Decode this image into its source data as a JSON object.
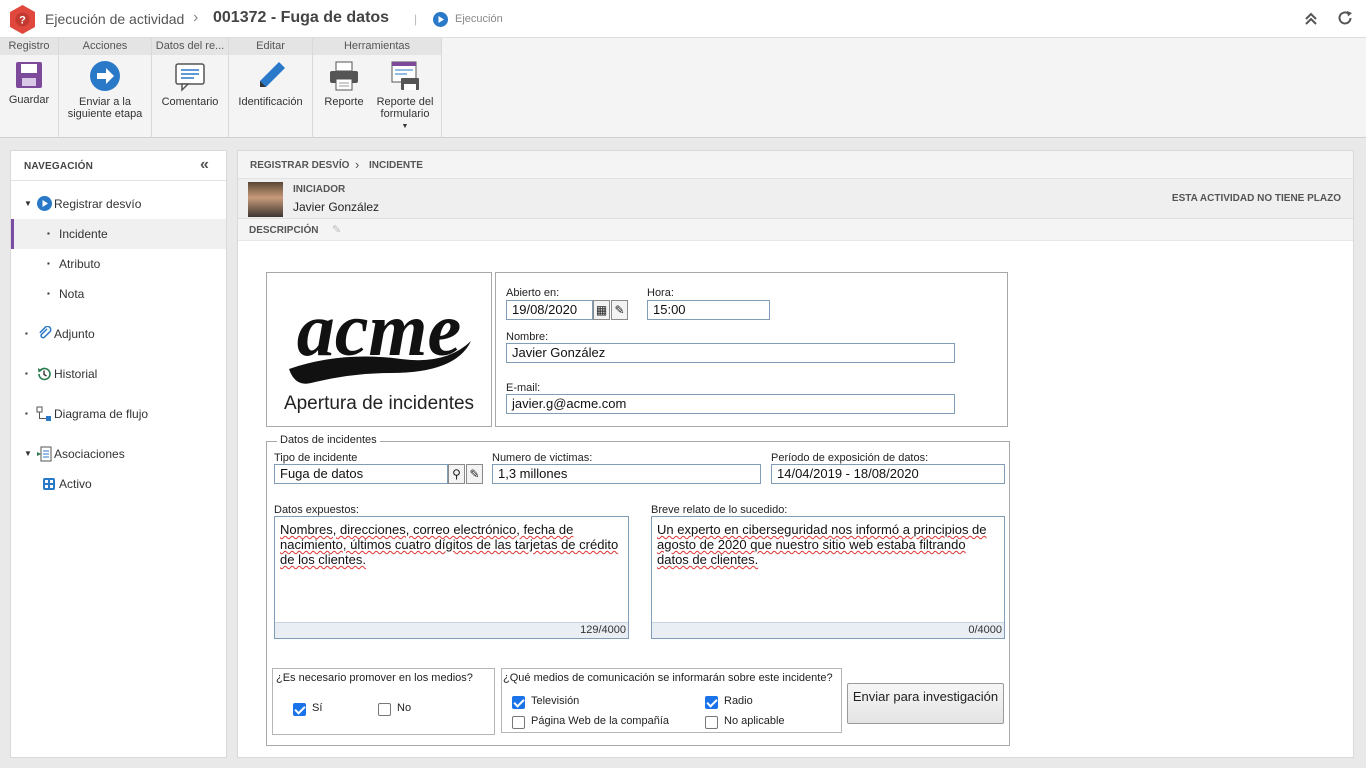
{
  "titlebar": {
    "activity": "Ejecución de actividad",
    "record_title": "001372 - Fuga de datos",
    "separator": "|",
    "status": "Ejecución"
  },
  "ribbon": {
    "groups": [
      {
        "label": "Registro"
      },
      {
        "label": "Acciones"
      },
      {
        "label": "Datos del re..."
      },
      {
        "label": "Editar"
      },
      {
        "label": "Herramientas"
      }
    ],
    "buttons": {
      "save": "Guardar",
      "next_step": "Enviar a la siguiente etapa",
      "comment": "Comentario",
      "identification": "Identificación",
      "report": "Reporte",
      "form_report": "Reporte del formulario"
    }
  },
  "nav": {
    "title": "NAVEGACIÓN",
    "items": [
      {
        "label": "Registrar desvío",
        "icon": "play-circle-icon"
      },
      {
        "label": "Incidente"
      },
      {
        "label": "Atributo"
      },
      {
        "label": "Nota"
      },
      {
        "label": "Adjunto",
        "icon": "paperclip-icon"
      },
      {
        "label": "Historial",
        "icon": "history-icon"
      },
      {
        "label": "Diagrama de flujo",
        "icon": "flowchart-icon"
      },
      {
        "label": "Asociaciones",
        "icon": "associations-icon"
      },
      {
        "label": "Activo",
        "icon": "asset-icon"
      }
    ]
  },
  "main": {
    "breadcrumb": [
      "REGISTRAR DESVÍO",
      "INCIDENTE"
    ],
    "initiator_label": "INICIADOR",
    "initiator_name": "Javier González",
    "deadline_note": "ESTA ACTIVIDAD NO TIENE PLAZO",
    "description_label": "DESCRIPCIÓN"
  },
  "form": {
    "logo_text": "acme",
    "logo_subtitle": "Apertura de incidentes",
    "opened_label": "Abierto en:",
    "opened_value": "19/08/2020",
    "time_label": "Hora:",
    "time_value": "15:00",
    "name_label": "Nombre:",
    "name_value": "Javier González",
    "email_label": "E-mail:",
    "email_value": "javier.g@acme.com",
    "incident_section": "Datos de incidentes",
    "incident_type_label": "Tipo de incidente",
    "incident_type_value": "Fuga de datos",
    "victims_label": "Numero de victimas:",
    "victims_value": "1,3 millones",
    "exposure_label": "Período de exposición de datos:",
    "exposure_value": "14/04/2019 - 18/08/2020",
    "exposed_label": "Datos expuestos:",
    "exposed_value": "Nombres, direcciones, correo electrónico, fecha de nacimiento, últimos cuatro dígitos de las tarjetas de crédito de los clientes.",
    "exposed_counter": "129/4000",
    "summary_label": "Breve relato de lo sucedido:",
    "summary_value": "Un experto en ciberseguridad nos informó a principios de agosto de 2020 que nuestro sitio web estaba filtrando datos de clientes.",
    "summary_counter": "0/4000",
    "promote_question": "¿Es necesario promover en los medios?",
    "promote_yes": "Sí",
    "promote_no": "No",
    "media_question": "¿Qué medios de comunicación se informarán sobre este incidente?",
    "media_tv": "Televisión",
    "media_radio": "Radio",
    "media_web": "Página Web de la compañía",
    "media_na": "No aplicable",
    "send_button": "Enviar para investigación",
    "checks": {
      "promote_yes": true,
      "promote_no": false,
      "tv": true,
      "radio": true,
      "web": false,
      "na": false
    }
  },
  "colors": {
    "accent": "#2a79c8",
    "brand_icon": "#e0483e",
    "active_marker": "#7a4ea5",
    "checkbox": "#1a73e8"
  }
}
